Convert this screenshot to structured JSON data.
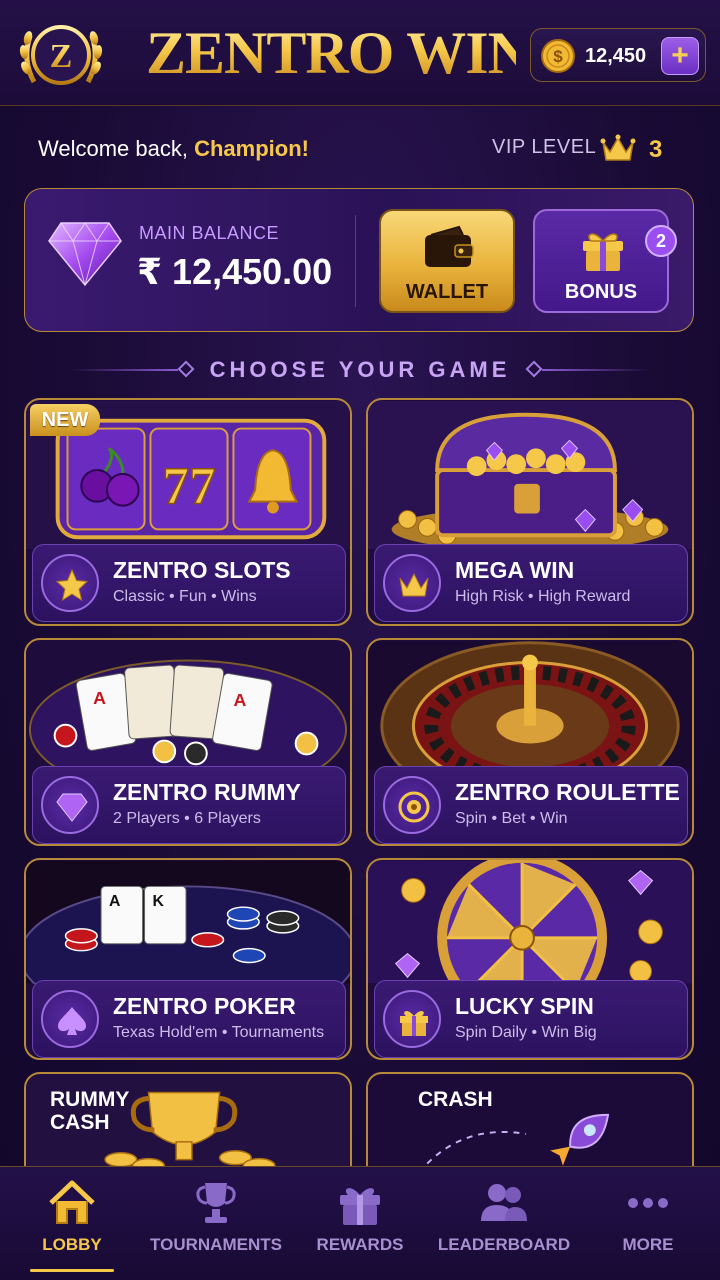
{
  "header": {
    "logo_letter": "Z",
    "brand": "ZENTRO WIN",
    "coins": "12,450",
    "add_label": "+"
  },
  "welcome": {
    "prefix": "Welcome back,",
    "name": "Champion!",
    "vip_label": "VIP LEVEL",
    "vip_level": "3"
  },
  "balance": {
    "label": "MAIN BALANCE",
    "value": "₹ 12,450.00",
    "wallet_label": "WALLET",
    "bonus_label": "BONUS",
    "bonus_count": "2"
  },
  "section_title": "CHOOSE YOUR GAME",
  "games": [
    {
      "title": "ZENTRO SLOTS",
      "subtitle": "Classic • Fun • Wins",
      "icon": "star-icon",
      "badge": "NEW"
    },
    {
      "title": "MEGA WIN",
      "subtitle": "High Risk • High Reward",
      "icon": "crown-icon"
    },
    {
      "title": "ZENTRO RUMMY",
      "subtitle": "2 Players • 6 Players",
      "icon": "diamond-icon"
    },
    {
      "title": "ZENTRO ROULETTE",
      "subtitle": "Spin • Bet • Win",
      "icon": "roulette-icon"
    },
    {
      "title": "ZENTRO POKER",
      "subtitle": "Texas Hold'em • Tournaments",
      "icon": "spade-icon"
    },
    {
      "title": "LUCKY SPIN",
      "subtitle": "Spin Daily • Win Big",
      "icon": "gift-icon"
    }
  ],
  "partial_games": [
    {
      "title_line1": "RUMMY",
      "title_line2": "CASH"
    },
    {
      "title_line1": "CRASH"
    }
  ],
  "nav": [
    {
      "label": "LOBBY",
      "icon": "home-icon",
      "active": true
    },
    {
      "label": "TOURNAMENTS",
      "icon": "trophy-icon"
    },
    {
      "label": "REWARDS",
      "icon": "gift-icon"
    },
    {
      "label": "LEADERBOARD",
      "icon": "users-icon"
    },
    {
      "label": "MORE",
      "icon": "more-icon"
    }
  ],
  "colors": {
    "gold": "#f6c84a",
    "purple": "#3a1a72",
    "background": "#1a0b36"
  }
}
